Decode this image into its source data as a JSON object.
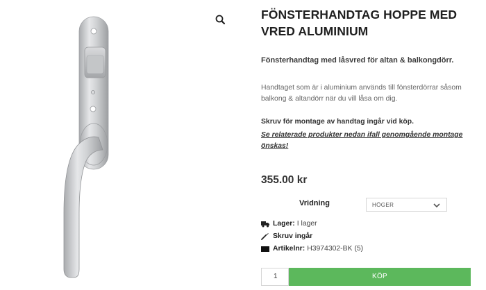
{
  "product": {
    "title": "FÖNSTERHANDTAG HOPPE MED VRED ALUMINIUM",
    "lead": "Fönsterhandtag med låsvred för altan & balkongdörr.",
    "description": "Handtaget som är i aluminium används till fönsterdörrar såsom balkong & altandörr när du vill låsa om dig.",
    "screw_note": "Skruv för montage av handtag ingår vid köp.",
    "related_link": "Se relaterade produkter nedan ifall genomgående montage önskas!",
    "price": "355.00 kr"
  },
  "variation": {
    "label": "Vridning",
    "selected": "HÖGER"
  },
  "meta": {
    "stock_label": "Lager:",
    "stock_value": "I lager",
    "screw_text": "Skruv ingår",
    "sku_label": "Artikelnr:",
    "sku_value": "H3974302-BK (5)"
  },
  "cart": {
    "quantity": "1",
    "buy_label": "KÖP"
  },
  "icons": {
    "zoom": "magnifier-icon",
    "stock": "truck-icon",
    "screw": "screwdriver-icon",
    "sku": "barcode-icon",
    "select": "chevron-down-icon"
  },
  "colors": {
    "buy_button": "#5cb85c",
    "title": "#1f1f1f"
  }
}
